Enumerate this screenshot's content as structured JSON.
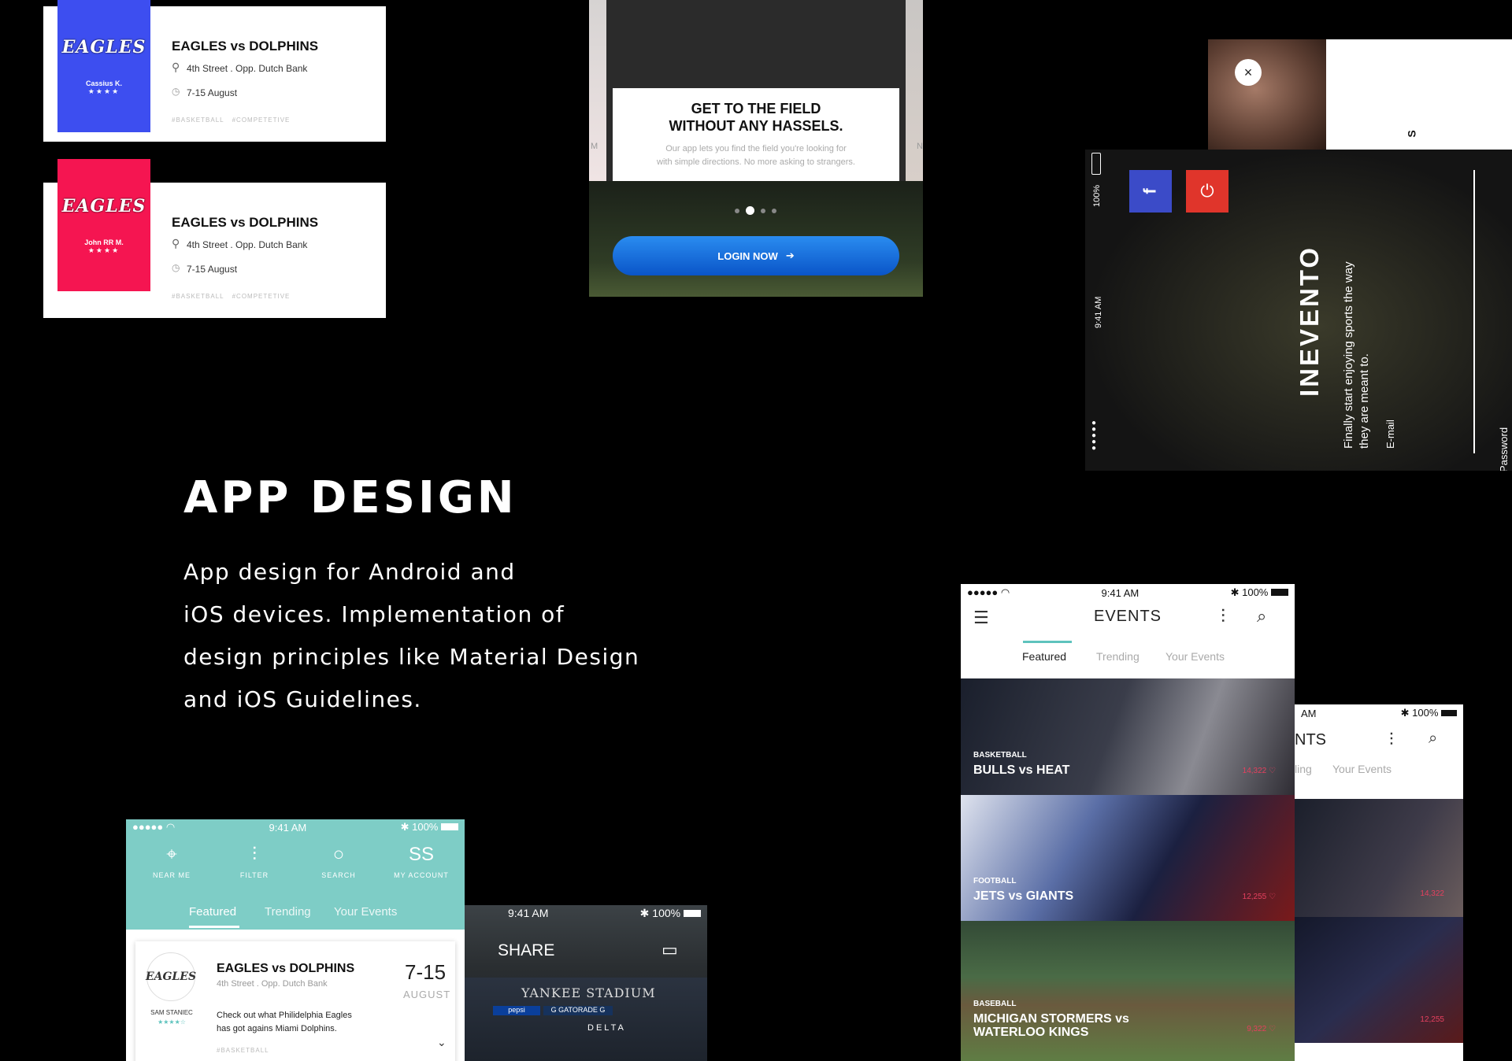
{
  "cards": [
    {
      "logo": "EAGLES",
      "user": "Cassius K.",
      "stars": "★★★★",
      "title": "EAGLES vs DOLPHINS",
      "location": "4th Street . Opp. Dutch Bank",
      "date": "7-15 August",
      "tags": [
        "#BASKETBALL",
        "#COMPETETIVE"
      ],
      "color": "#3d4ef0"
    },
    {
      "logo": "EAGLES",
      "user": "John RR M.",
      "stars": "★★★★",
      "title": "EAGLES vs DOLPHINS",
      "location": "4th Street . Opp. Dutch Bank",
      "date": "7-15 August",
      "tags": [
        "#BASKETBALL",
        "#COMPETETIVE"
      ],
      "color": "#f51551"
    }
  ],
  "onboarding": {
    "title_line1": "GET TO THE FIELD",
    "title_line2": "WITHOUT ANY HASSELS.",
    "subtitle_line1": "Our app lets you find the field you're looking for",
    "subtitle_line2": "with simple directions. No more asking to strangers.",
    "login_label": "LOGIN NOW",
    "side_letter_left": "M",
    "side_letter_right": "N"
  },
  "login_screen": {
    "time": "9:41 AM",
    "battery": "100%",
    "fb_label": "f",
    "brand": "INEVENTO",
    "tagline1": "Finally start enjoying sports the way",
    "tagline2": "they are meant to.",
    "email_label": "E-mail",
    "password_label": "Password",
    "close_label": "×",
    "top_panel_text": "S"
  },
  "heading": {
    "title": "APP DESIGN",
    "line1": "App design for Android and",
    "line2": "iOS devices. Implementation of",
    "line3": "design principles like Material Design",
    "line4": "and iOS Guidelines."
  },
  "events_phone": {
    "time": "9:41 AM",
    "battery": "100%",
    "title": "EVENTS",
    "tabs": [
      "Featured",
      "Trending",
      "Your Events"
    ],
    "rows": [
      {
        "category": "BASKETBALL",
        "name": "BULLS vs HEAT",
        "likes": "14,322"
      },
      {
        "category": "FOOTBALL",
        "name": "JETS vs GIANTS",
        "likes": "12,255"
      },
      {
        "category": "BASEBALL",
        "name_line1": "MICHIGAN STORMERS vs",
        "name_line2": "WATERLOO KINGS",
        "likes": "9,322"
      }
    ]
  },
  "events_phone2": {
    "time": "AM",
    "battery": "100%",
    "title": "NTS",
    "tab_partial": "ling",
    "tab_your": "Your Events",
    "likes1": "14,322",
    "likes2": "12,255"
  },
  "teal_phone": {
    "time": "9:41 AM",
    "battery": "100%",
    "nav": [
      {
        "icon": "⌖",
        "label": "NEAR ME"
      },
      {
        "icon": "⫶",
        "label": "FILTER"
      },
      {
        "icon": "○",
        "label": "SEARCH"
      },
      {
        "icon": "SS",
        "label": "MY ACCOUNT"
      }
    ],
    "tabs": [
      "Featured",
      "Trending",
      "Your Events"
    ],
    "card": {
      "logo": "EAGLES",
      "user": "SAM STANIEC",
      "stars": "★★★★☆",
      "title": "EAGLES vs DOLPHINS",
      "location": "4th Street . Opp. Dutch Bank",
      "date_num": "7-15",
      "date_month": "AUGUST",
      "desc_line1": "Check out what Philidelphia Eagles",
      "desc_line2": "has got agains Miami Dolphins.",
      "tag": "#BASKETBALL"
    }
  },
  "share_phone": {
    "time": "9:41 AM",
    "battery": "100%",
    "title": "SHARE",
    "stadium": "YANKEE STADIUM",
    "sign_delta": "DELTA",
    "sign_pepsi": "pepsi",
    "sign_gatorade": "G GATORADE G"
  }
}
